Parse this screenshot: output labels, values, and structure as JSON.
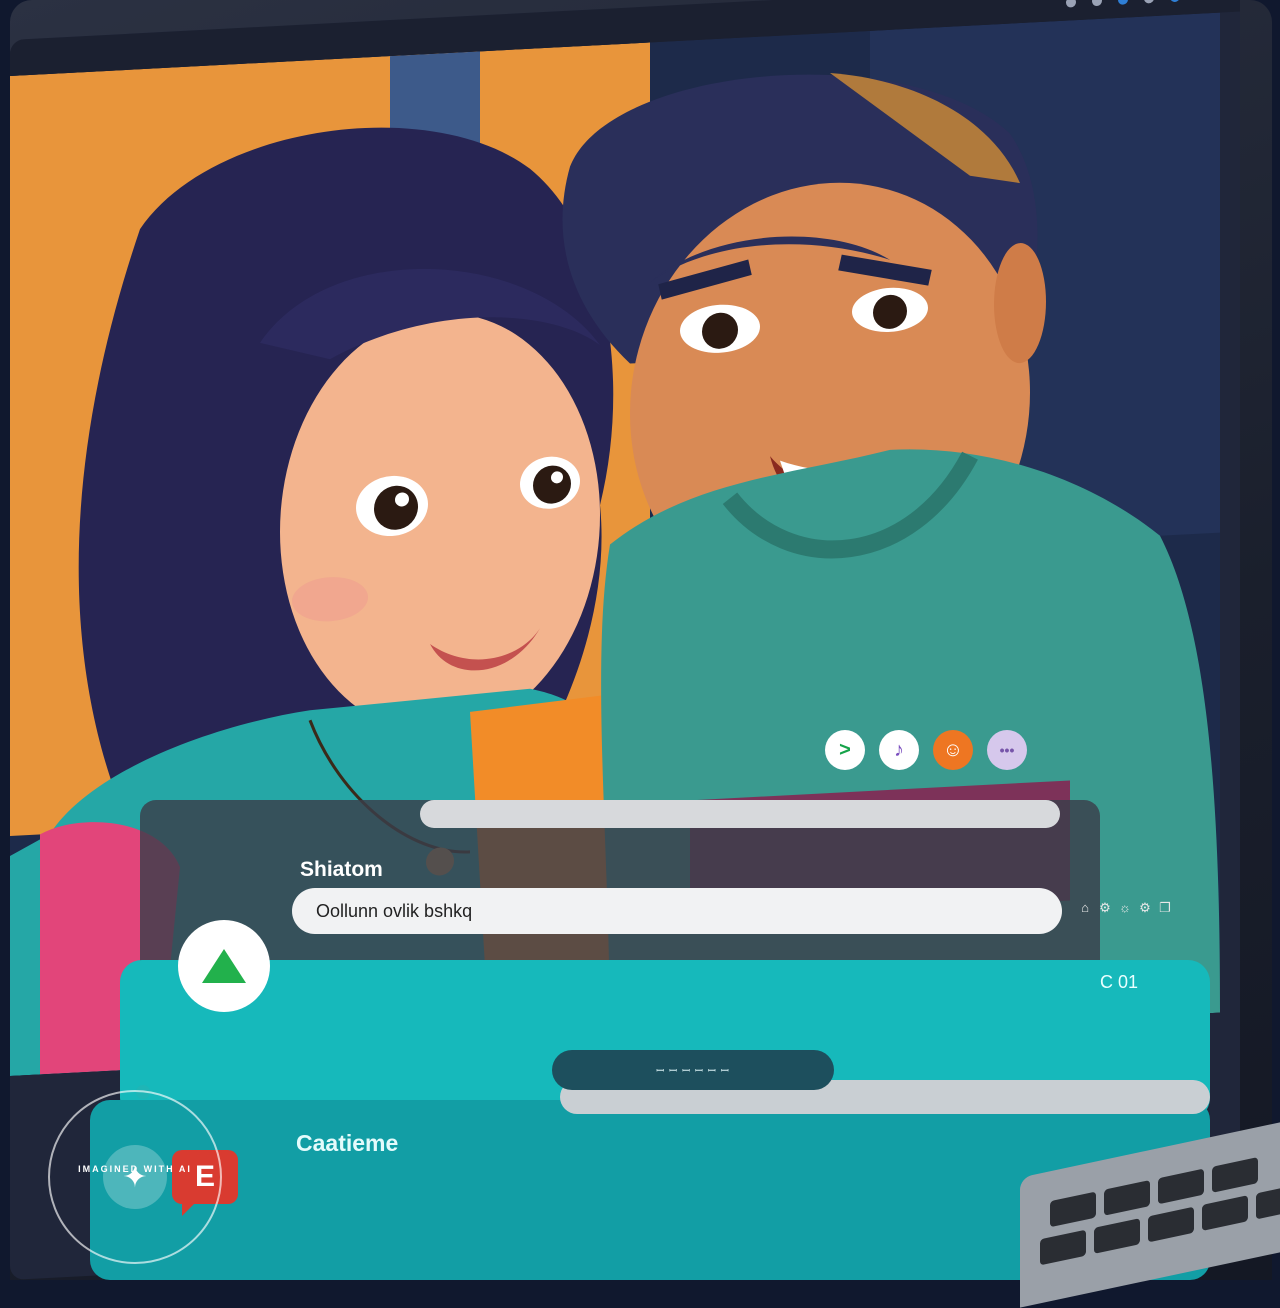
{
  "chat": {
    "contact_name": "Shiatom",
    "input_value": "Oollunn ovlik bshkq",
    "status_icons": [
      "⌂",
      "⚙",
      "☼",
      "⚙",
      "❐"
    ]
  },
  "reactions": [
    {
      "name": "send-reaction-button",
      "glyph": ">"
    },
    {
      "name": "like-reaction-button",
      "glyph": "♪"
    },
    {
      "name": "emoji-reaction-button",
      "glyph": "☺"
    },
    {
      "name": "more-reaction-button",
      "glyph": "•••"
    }
  ],
  "panel": {
    "time_label": "C 01",
    "pill_text": "ꟷ ꟷ ꟷ ꟷ ꟷ ꟷ"
  },
  "dock": {
    "app_name": "Caatieme",
    "app_icon_glyph": "E"
  },
  "watermark": {
    "text": "IMAGINED WITH AI",
    "icon_glyph": "✦"
  },
  "colors": {
    "teal": "#16b9bb",
    "dark_teal": "#1d4f5d",
    "orange_bg": "#e8953b",
    "navy_bg": "#1d2a4a",
    "accent_green": "#22b14c",
    "accent_red": "#d93b30"
  }
}
